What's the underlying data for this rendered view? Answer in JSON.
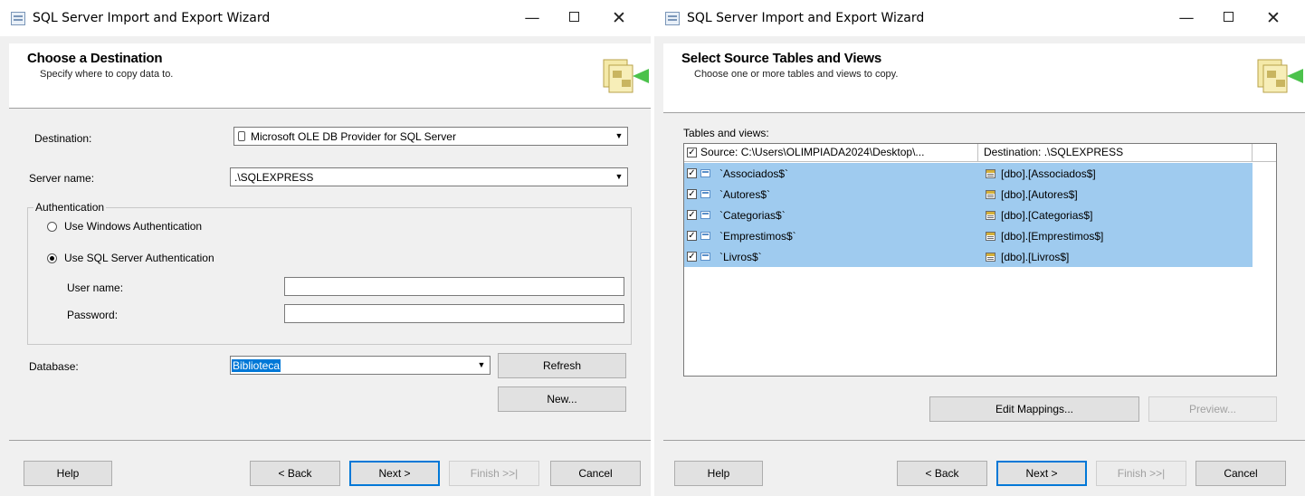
{
  "window_left": {
    "title": "SQL Server Import and Export Wizard",
    "controls": {
      "minimize": "—",
      "close": "✕"
    },
    "header": {
      "title": "Choose a Destination",
      "subtitle": "Specify where to copy data to."
    },
    "destination": {
      "label": "Destination:",
      "value": "Microsoft OLE DB Provider for SQL Server"
    },
    "server": {
      "label": "Server name:",
      "value": ".\\SQLEXPRESS"
    },
    "authentication": {
      "legend": "Authentication",
      "windows_label": "Use Windows Authentication",
      "sql_label": "Use SQL Server Authentication",
      "selected": "sql",
      "username_label": "User name:",
      "username_value": "",
      "password_label": "Password:",
      "password_value": ""
    },
    "database": {
      "label": "Database:",
      "value": "Biblioteca"
    },
    "buttons": {
      "refresh": "Refresh",
      "new": "New...",
      "help": "Help",
      "back": "< Back",
      "next": "Next >",
      "finish": "Finish >>|",
      "cancel": "Cancel"
    }
  },
  "window_right": {
    "title": "SQL Server Import and Export Wizard",
    "controls": {
      "minimize": "—",
      "close": "✕"
    },
    "header": {
      "title": "Select Source Tables and Views",
      "subtitle": "Choose one or more tables and views to copy."
    },
    "tables_label": "Tables and views:",
    "columns": {
      "source": "Source: C:\\Users\\OLIMPIADA2024\\Desktop\\...",
      "destination": "Destination: .\\SQLEXPRESS"
    },
    "rows": [
      {
        "source": "`Associados$`",
        "destination": "[dbo].[Associados$]",
        "checked": true
      },
      {
        "source": "`Autores$`",
        "destination": "[dbo].[Autores$]",
        "checked": true
      },
      {
        "source": "`Categorias$`",
        "destination": "[dbo].[Categorias$]",
        "checked": true
      },
      {
        "source": "`Emprestimos$`",
        "destination": "[dbo].[Emprestimos$]",
        "checked": true
      },
      {
        "source": "`Livros$`",
        "destination": "[dbo].[Livros$]",
        "checked": true
      }
    ],
    "buttons": {
      "edit_mappings": "Edit Mappings...",
      "preview": "Preview...",
      "help": "Help",
      "back": "< Back",
      "next": "Next >",
      "finish": "Finish >>|",
      "cancel": "Cancel"
    }
  }
}
